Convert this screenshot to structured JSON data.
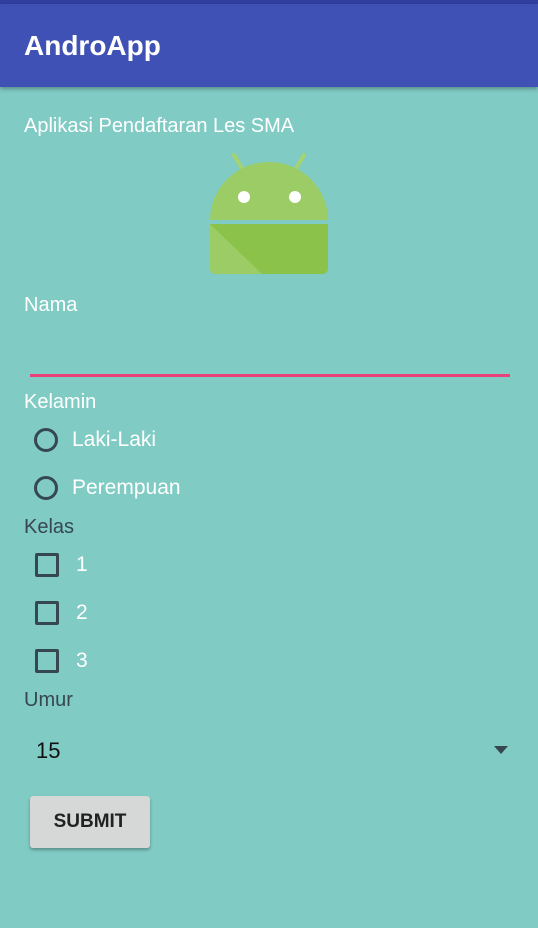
{
  "appbar": {
    "title": "AndroApp"
  },
  "form": {
    "subtitle": "Aplikasi Pendaftaran Les SMA",
    "nama_label": "Nama",
    "nama_value": "",
    "kelamin_label": "Kelamin",
    "kelamin_options": [
      "Laki-Laki",
      "Perempuan"
    ],
    "kelas_label": "Kelas",
    "kelas_options": [
      "1",
      "2",
      "3"
    ],
    "umur_label": "Umur",
    "umur_value": "15",
    "submit_label": "SUBMIT"
  },
  "colors": {
    "background": "#80cbc4",
    "appbar": "#3f51b5",
    "accent": "#ec407a",
    "android_green": "#8bc34a"
  },
  "icons": {
    "logo": "android-robot-icon",
    "dropdown": "dropdown-arrow-icon"
  }
}
